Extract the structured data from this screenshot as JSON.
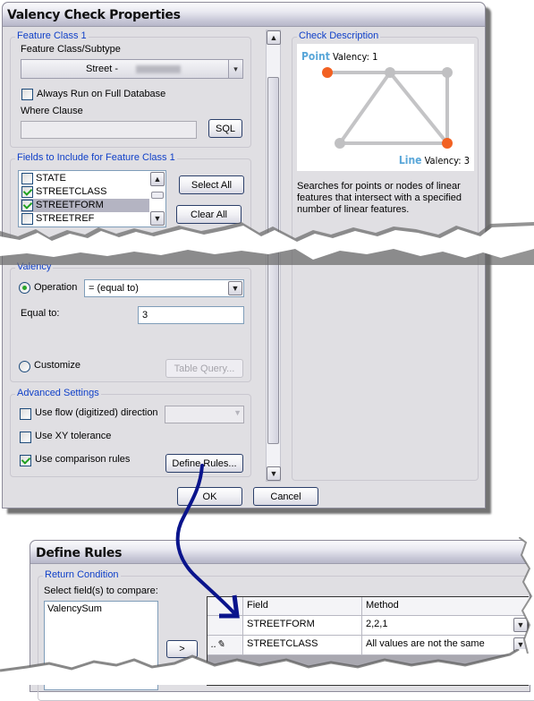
{
  "main_dialog": {
    "title": "Valency Check Properties",
    "feature_class": {
      "legend": "Feature Class 1",
      "subtype_label": "Feature Class/Subtype",
      "subtype_value": "Street - ",
      "always_run_label": "Always Run on Full Database",
      "always_run_checked": false,
      "where_clause_label": "Where Clause",
      "where_clause_value": "",
      "sql_button": "SQL"
    },
    "fields": {
      "legend": "Fields to Include for Feature Class 1",
      "items": [
        {
          "label": "STATE",
          "checked": false,
          "selected": false
        },
        {
          "label": "STREETCLASS",
          "checked": true,
          "selected": false
        },
        {
          "label": "STREETFORM",
          "checked": true,
          "selected": true
        },
        {
          "label": "STREETREF",
          "checked": false,
          "selected": false
        }
      ],
      "select_all_button": "Select All",
      "clear_all_button": "Clear All"
    },
    "check_description": {
      "legend": "Check Description",
      "point_word": "Point",
      "point_rest": " Valency: 1",
      "line_word": "Line",
      "line_rest": " Valency: 3",
      "description": "Searches for points or nodes of linear features that intersect with a specified number of linear features.",
      "colors": {
        "accent_word": "#5aa7d9",
        "endpoint": "#f26122",
        "node": "#c0c0c2",
        "line": "#c4c4c6"
      }
    },
    "valency": {
      "legend": "Valency",
      "operation_label": "Operation",
      "operation_selected": true,
      "operation_value": "= (equal to)",
      "equal_to_label": "Equal to:",
      "equal_to_value": "3",
      "customize_label": "Customize",
      "customize_selected": false,
      "table_query_button": "Table Query..."
    },
    "advanced": {
      "legend": "Advanced Settings",
      "use_flow_label": "Use flow (digitized) direction",
      "use_flow_checked": false,
      "use_flow_value": "",
      "use_xy_label": "Use XY tolerance",
      "use_xy_checked": false,
      "use_comparison_label": "Use comparison rules",
      "use_comparison_checked": true,
      "define_rules_button": "Define Rules..."
    },
    "ok_button": "OK",
    "cancel_button": "Cancel"
  },
  "define_rules_dialog": {
    "title": "Define Rules",
    "return_condition_legend": "Return Condition",
    "select_fields_label": "Select field(s) to compare:",
    "available_fields": [
      "ValencySum"
    ],
    "add_button": ">",
    "grid": {
      "headers": [
        "",
        "Field",
        "Method"
      ],
      "rows": [
        {
          "indicator": "",
          "field": "STREETFORM",
          "method": "2,2,1"
        },
        {
          "indicator": "pencil",
          "field": "STREETCLASS",
          "method": "All values are not the same"
        }
      ]
    }
  },
  "annotation": {
    "arrow_color": "#0a148c"
  }
}
